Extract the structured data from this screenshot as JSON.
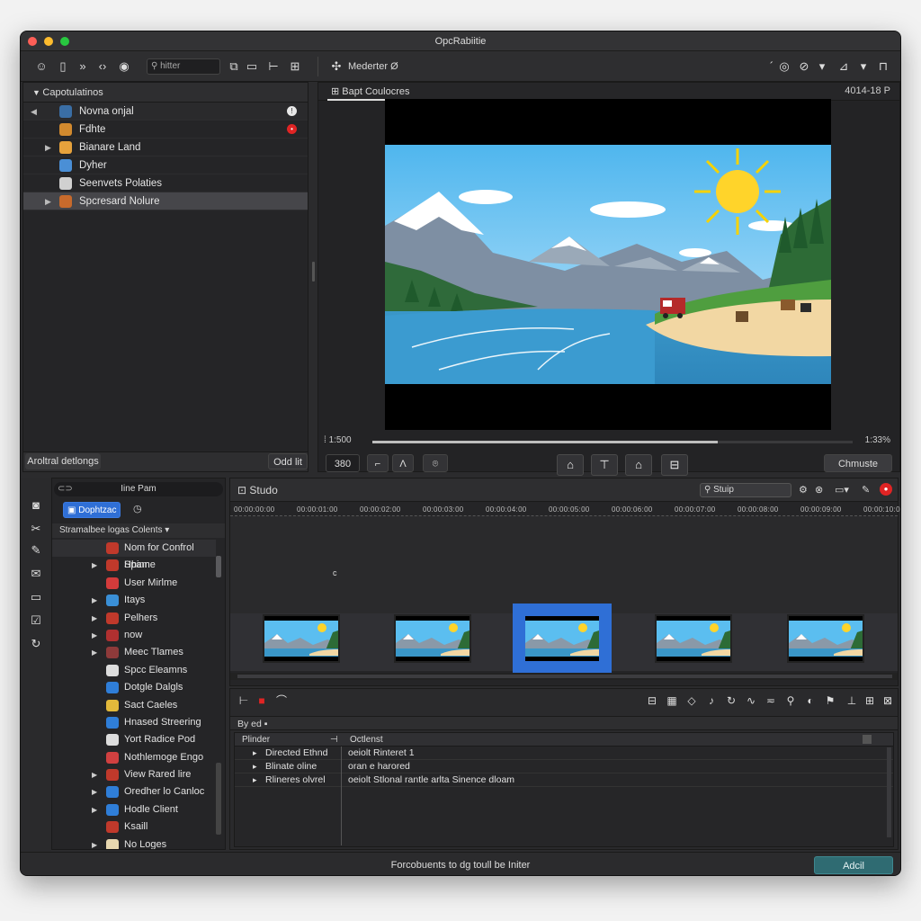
{
  "app": {
    "title": "OpcRabiitie"
  },
  "toolbar": {
    "search_placeholder": "hitter",
    "media_label": "Mederter",
    "media_suffix": "Ø"
  },
  "project_panel": {
    "header": "Capotulatinos",
    "items": [
      {
        "label": "Novna onjal",
        "arrow": "◀",
        "icon_color": "#3a6ea5",
        "badge": "!",
        "badge_color": "#e8e8e8"
      },
      {
        "label": "Fdhte",
        "arrow": "",
        "icon_color": "#d28a2e",
        "badge": "•",
        "badge_color": "#e02424"
      },
      {
        "label": "Bianare Land",
        "arrow": "▶",
        "icon_color": "#e6a23c",
        "badge": "",
        "badge_color": ""
      },
      {
        "label": "Dyher",
        "arrow": "",
        "icon_color": "#4a8fd6",
        "badge": "",
        "badge_color": ""
      },
      {
        "label": "Seenvets Polaties",
        "arrow": "",
        "icon_color": "#d0d0d0",
        "badge": "",
        "badge_color": ""
      },
      {
        "label": "Spcresard Nolure",
        "arrow": "▶",
        "icon_color": "#c76a2c",
        "badge": "",
        "badge_color": ""
      }
    ],
    "footer_left": "Aroltral detlongs",
    "footer_right": "Odd lit"
  },
  "viewer": {
    "tab_label": "Bapt Coulocres",
    "timecode_right": "4014-18",
    "time_left": "1:500",
    "time_right": "1:33%",
    "field_value": "380",
    "action_button": "Chmuste"
  },
  "library": {
    "header": "Iine Pam",
    "tab_label": "Dophtzac",
    "section": "Stramalbee logas Colents",
    "items": [
      {
        "label": "Nom for Confrol Hhinn",
        "arrow": "",
        "icon_color": "#c0392b"
      },
      {
        "label": "Spame",
        "arrow": "▶",
        "icon_color": "#c0392b"
      },
      {
        "label": "User Mirlme",
        "arrow": "",
        "icon_color": "#d43b3b"
      },
      {
        "label": "Itays",
        "arrow": "▶",
        "icon_color": "#3a8fd6"
      },
      {
        "label": "Pelhers",
        "arrow": "▶",
        "icon_color": "#c0392b"
      },
      {
        "label": "now",
        "arrow": "▶",
        "icon_color": "#b03030"
      },
      {
        "label": "Meec Tlames",
        "arrow": "▶",
        "icon_color": "#8e3a3a"
      },
      {
        "label": "Spcc Eleamns",
        "arrow": "",
        "icon_color": "#dddddd"
      },
      {
        "label": "Dotgle Dalgls",
        "arrow": "",
        "icon_color": "#2f7ed8"
      },
      {
        "label": "Sact Caeles",
        "arrow": "",
        "icon_color": "#e2b93b"
      },
      {
        "label": "Hnased Streering",
        "arrow": "",
        "icon_color": "#2f7ed8"
      },
      {
        "label": "Yort Radice Pod",
        "arrow": "",
        "icon_color": "#dddddd"
      },
      {
        "label": "Nothlemoge Engo",
        "arrow": "",
        "icon_color": "#d04040"
      },
      {
        "label": "View Rared lire",
        "arrow": "▶",
        "icon_color": "#c0392b"
      },
      {
        "label": "Oredher lo Canloc",
        "arrow": "▶",
        "icon_color": "#2f7ed8"
      },
      {
        "label": "Hodle Client",
        "arrow": "▶",
        "icon_color": "#2f7ed8"
      },
      {
        "label": "Ksaill",
        "arrow": "",
        "icon_color": "#c0392b"
      },
      {
        "label": "No Loges",
        "arrow": "▶",
        "icon_color": "#e8d8b0"
      }
    ]
  },
  "timeline": {
    "header": "Studo",
    "search_value": "Stuip",
    "ruler_labels": [
      "00:00:00:00",
      "00:00:01:00",
      "00:00:02:00",
      "00:00:03:00",
      "00:00:04:00",
      "00:00:05:00",
      "00:00:06:00",
      "00:00:07:00",
      "00:00:08:00",
      "00:00:09:00",
      "00:00:10:00"
    ],
    "cursor_mark": "c",
    "selected_thumb": 3
  },
  "properties": {
    "filter": "By ed",
    "col_left": "Plinder",
    "col_right": "Octlenst",
    "rows": [
      {
        "name": "Directed Ethnd",
        "value": "oeiolt Rinteret 1"
      },
      {
        "name": "Blinate oline",
        "value": "oran e harored"
      },
      {
        "name": "Rlineres olvrel",
        "value": "oeiolt Stlonal rantle arlta Sinence dloam"
      }
    ]
  },
  "status": {
    "message": "Forcobuents to dg toull be Initer",
    "apply_button": "Adcil"
  },
  "colors": {
    "accent_blue": "#2f6fd6",
    "apply_teal": "#2f6b72",
    "record_red": "#e02424"
  }
}
